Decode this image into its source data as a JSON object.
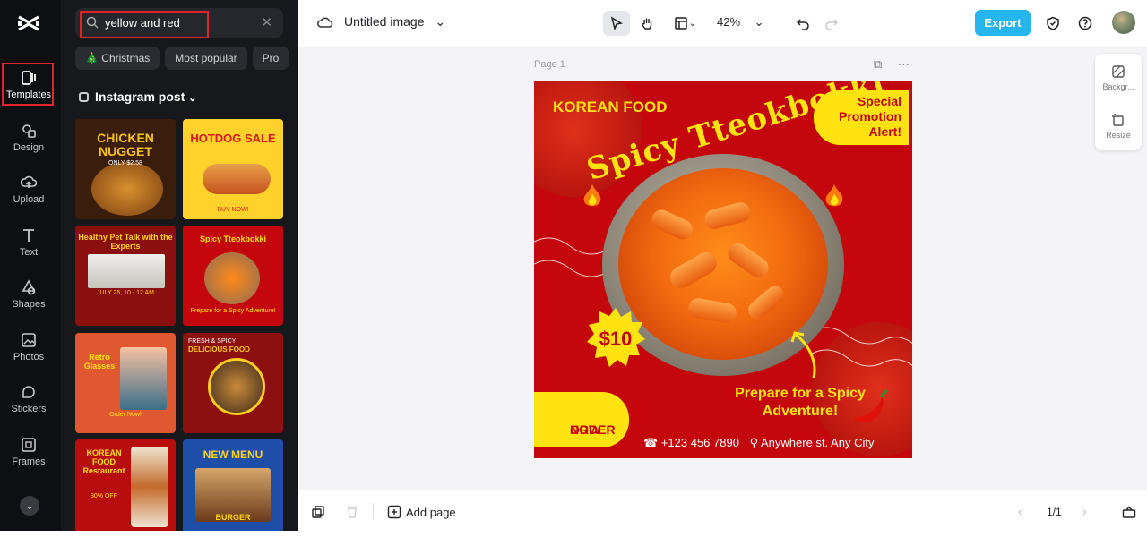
{
  "rail": {
    "items": [
      {
        "label": "Templates",
        "icon": "templates-icon",
        "active": true
      },
      {
        "label": "Design",
        "icon": "design-icon"
      },
      {
        "label": "Upload",
        "icon": "upload-icon"
      },
      {
        "label": "Text",
        "icon": "text-icon"
      },
      {
        "label": "Shapes",
        "icon": "shapes-icon"
      },
      {
        "label": "Photos",
        "icon": "photos-icon"
      },
      {
        "label": "Stickers",
        "icon": "stickers-icon"
      },
      {
        "label": "Frames",
        "icon": "frames-icon"
      }
    ]
  },
  "panel": {
    "search_value": "yellow and red",
    "chips": [
      "🎄 Christmas",
      "Most popular",
      "Pro"
    ],
    "section_title": "Instagram post",
    "templates": [
      {
        "title": "CHICKEN NUGGET",
        "sub": "ONLY $2.58"
      },
      {
        "title": "HOTDOG SALE",
        "sub": "BUY NOW!"
      },
      {
        "title": "Healthy Pet Talk with the Experts",
        "sub": "JULY 25, 10 - 12 AM"
      },
      {
        "title": "Spicy Tteokbokki",
        "sub": "Prepare for a Spicy Adventure!"
      },
      {
        "title": "Retro Glasses",
        "sub": "Order Now!"
      },
      {
        "title": "DELICIOUS FOOD",
        "sub": "FRESH & SPICY"
      },
      {
        "title": "KOREAN FOOD Restaurant",
        "sub": "30% OFF"
      },
      {
        "title": "NEW MENU",
        "sub": "BURGER"
      }
    ]
  },
  "topbar": {
    "doc_title": "Untitled image",
    "zoom": "42%",
    "export_label": "Export"
  },
  "canvas": {
    "page_label": "Page 1",
    "side_tools": [
      "Backgr...",
      "Resize"
    ],
    "design": {
      "korean_food": "KOREAN FOOD",
      "special": [
        "Special",
        "Promotion",
        "Alert!"
      ],
      "title": "Spicy Tteokbokki",
      "price": "$10",
      "prepare": "Prepare for a Spicy Adventure!",
      "order": [
        "ORDER",
        "NOW"
      ],
      "phone": "+123 456 7890",
      "address": "Anywhere st. Any City"
    }
  },
  "bottombar": {
    "add_page": "Add page",
    "pager": "1/1"
  },
  "colors": {
    "brand_red": "#c4070c",
    "brand_yellow": "#ffe310",
    "export_blue": "#25b5ef",
    "highlight_red": "#e0242b"
  }
}
